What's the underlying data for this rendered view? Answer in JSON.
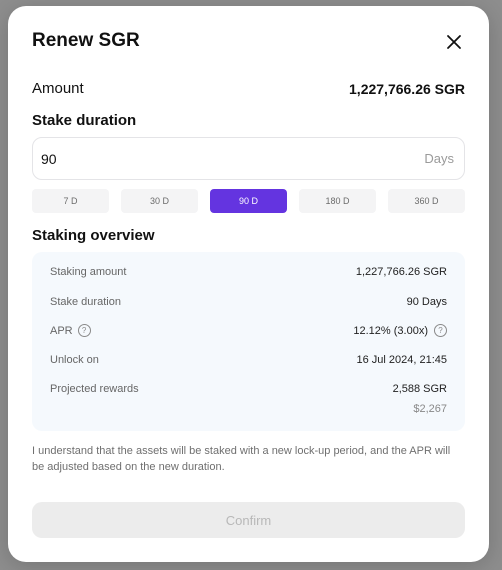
{
  "modal": {
    "title": "Renew SGR",
    "amount_label": "Amount",
    "amount_value": "1,227,766.26 SGR",
    "stake_duration_label": "Stake duration",
    "duration_input": {
      "value": "90",
      "unit": "Days"
    },
    "duration_options": [
      "7 D",
      "30 D",
      "90 D",
      "180 D",
      "360 D"
    ],
    "selected_option": "90 D",
    "overview_title": "Staking overview",
    "overview": {
      "staking_amount_label": "Staking amount",
      "staking_amount_value": "1,227,766.26 SGR",
      "stake_duration_label": "Stake duration",
      "stake_duration_value": "90 Days",
      "apr_label": "APR",
      "apr_value": "12.12% (3.00x)",
      "unlock_label": "Unlock on",
      "unlock_value": "16 Jul 2024, 21:45",
      "rewards_label": "Projected rewards",
      "rewards_value": "2,588 SGR",
      "rewards_usd": "$2,267"
    },
    "disclaimer": "I understand that the assets will be staked with a new lock-up period, and the APR will be adjusted based on the new duration.",
    "confirm_label": "Confirm",
    "colors": {
      "accent": "#6434e0",
      "overview_bg": "#f5f9fd",
      "disabled_bg": "#ececec"
    }
  }
}
